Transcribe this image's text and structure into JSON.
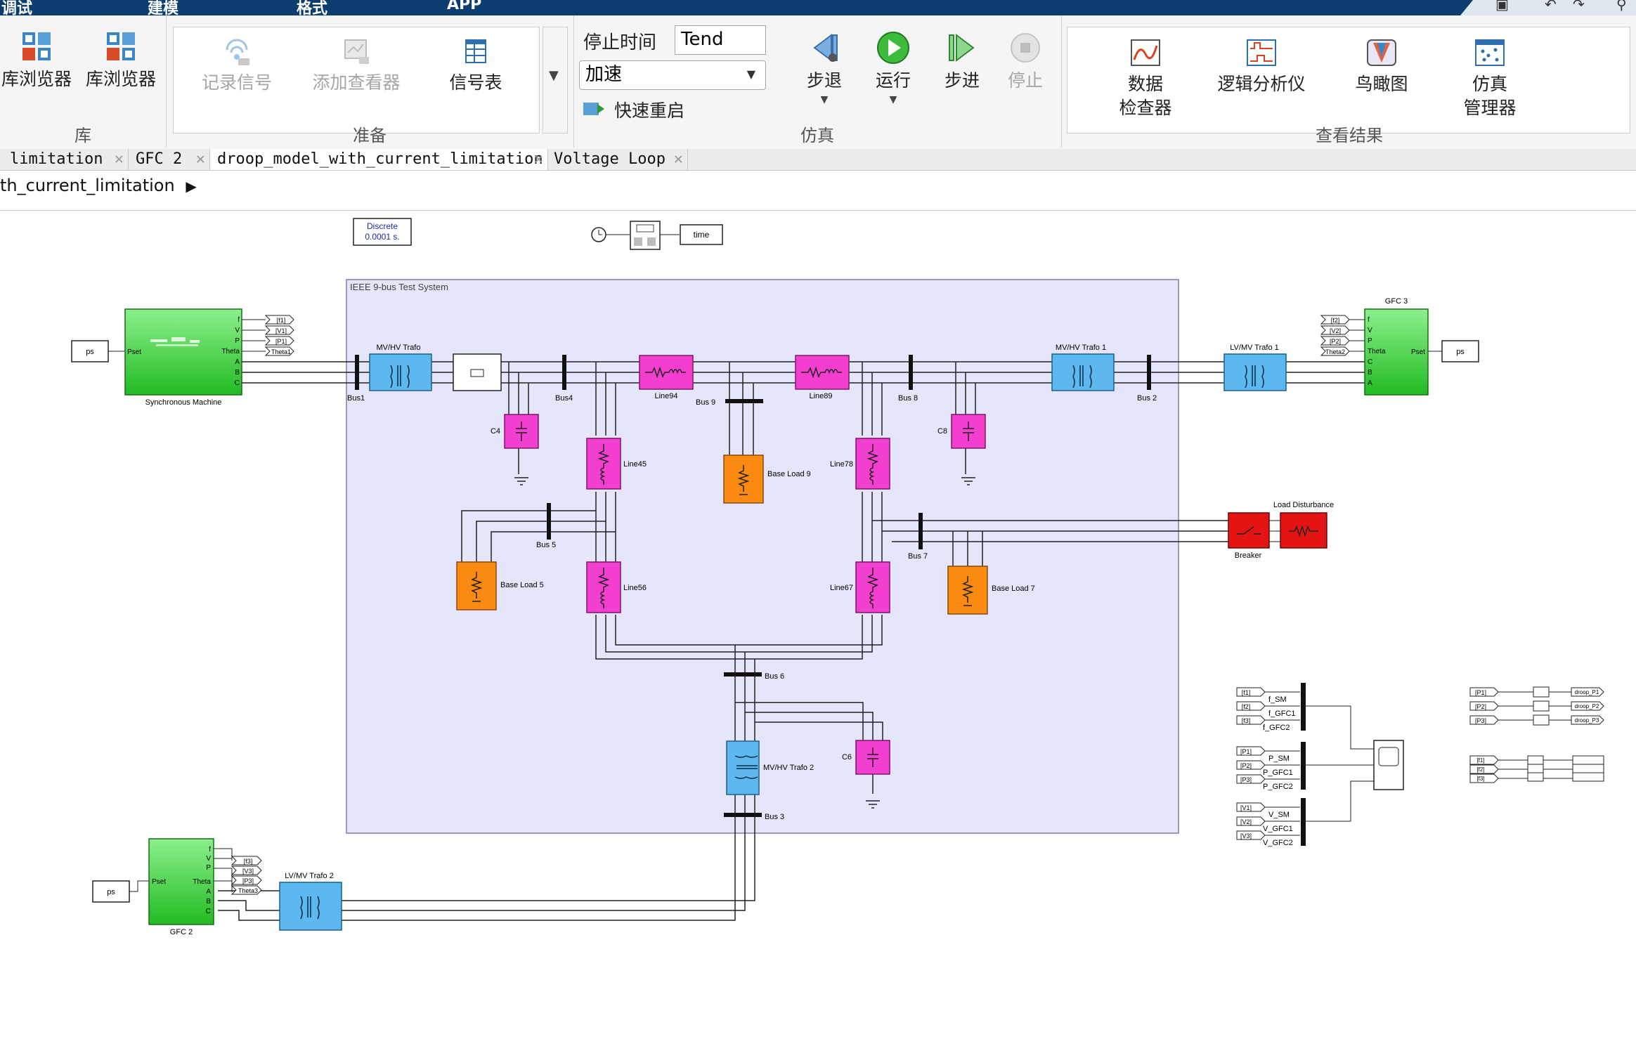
{
  "menu": {
    "tabs": [
      "调试",
      "建模",
      "格式",
      "APP"
    ]
  },
  "ribbon": {
    "library": {
      "btn1": "库浏览器",
      "btn2": "库浏览器",
      "label": "库"
    },
    "prepare": {
      "record": "记录信号",
      "add_viewer": "添加查看器",
      "signal_table": "信号表",
      "label": "准备"
    },
    "sim": {
      "stop_time_label": "停止时间",
      "stop_time_value": "Tend",
      "mode": "加速",
      "fast_restart": "快速重启",
      "step_back": "步退",
      "run": "运行",
      "step_fwd": "步进",
      "stop": "停止",
      "label": "仿真"
    },
    "results": {
      "data_inspector_1": "数据",
      "data_inspector_2": "检查器",
      "logic_analyzer": "逻辑分析仪",
      "birdseye": "鸟瞰图",
      "sim_mgr_1": "仿真",
      "sim_mgr_2": "管理器",
      "label": "查看结果"
    }
  },
  "tabs": [
    {
      "label": "limitation",
      "active": false
    },
    {
      "label": "GFC 2",
      "active": false
    },
    {
      "label": "droop_model_with_current_limitation",
      "active": true
    },
    {
      "label": "Voltage Loop",
      "active": false
    }
  ],
  "breadcrumb": "th_current_limitation",
  "model": {
    "powergui_1": "Discrete",
    "powergui_2": "0.0001 s.",
    "time_label": "time",
    "area_title": "IEEE 9-bus Test System",
    "sm_label": "Synchronous Machine",
    "gfc3_title": "GFC 3",
    "gfc2_label": "GFC 2",
    "ps": "ps",
    "pset": "Pset",
    "ports_f": "f",
    "ports_v": "V",
    "ports_p": "P",
    "ports_theta": "Theta",
    "ports_a": "A",
    "ports_b": "B",
    "ports_c": "C",
    "goto_sm": [
      "[f1]",
      "[V1]",
      "[P1]",
      "Theta1"
    ],
    "goto_gfc3": [
      "[f2]",
      "[V2]",
      "[P2]",
      "Theta2"
    ],
    "goto_gfc2": [
      "[f3]",
      "[V3]",
      "[P3]",
      "Theta3"
    ],
    "trafo_mvhv": "MV/HV Trafo",
    "trafo_mvhv1": "MV/HV Trafo 1",
    "trafo_lvmv1": "LV/MV Trafo 1",
    "trafo_mvhv2": "MV/HV Trafo 2",
    "trafo_lvmv2": "LV/MV Trafo 2",
    "bus1": "Bus1",
    "bus4": "Bus4",
    "bus9": "Bus 9",
    "bus8": "Bus 8",
    "bus2": "Bus 2",
    "bus5": "Bus 5",
    "bus7": "Bus 7",
    "bus6": "Bus 6",
    "bus3": "Bus 3",
    "line94": "Line94",
    "line89": "Line89",
    "line45": "Line45",
    "line78": "Line78",
    "line56": "Line56",
    "line67": "Line67",
    "c4": "C4",
    "c8": "C8",
    "c6": "C6",
    "load9": "Base Load 9",
    "load5": "Base Load 5",
    "load7": "Base Load 7",
    "breaker": "Breaker",
    "load_dist": "Load Disturbance",
    "scope_f": [
      "[f1]",
      "[f2]",
      "[f3]"
    ],
    "scope_f_sig": [
      "f_SM",
      "f_GFC1",
      "f_GFC2"
    ],
    "scope_p": [
      "[P1]",
      "[P2]",
      "[P3]"
    ],
    "scope_p_sig": [
      "P_SM",
      "P_GFC1",
      "P_GFC2"
    ],
    "scope_v": [
      "[V1]",
      "[V2]",
      "[V3]"
    ],
    "scope_v_sig": [
      "V_SM",
      "V_GFC1",
      "V_GFC2"
    ],
    "droop_in": [
      "[P1]",
      "[P2]",
      "[P3]"
    ],
    "droop_out": [
      "droop_P1",
      "droop_P2",
      "droop_P3"
    ],
    "mux_in": [
      "[f1]",
      "[f2]",
      "[f3]"
    ]
  },
  "colors": {
    "title_bar": "#0d3d6e",
    "area": "#e5e5fb",
    "sync_green": "#34c634",
    "trafo_blue": "#5cb8ee",
    "line_pink": "#f23fcf",
    "load_orange": "#fb8a12",
    "breaker_red": "#e41414"
  }
}
